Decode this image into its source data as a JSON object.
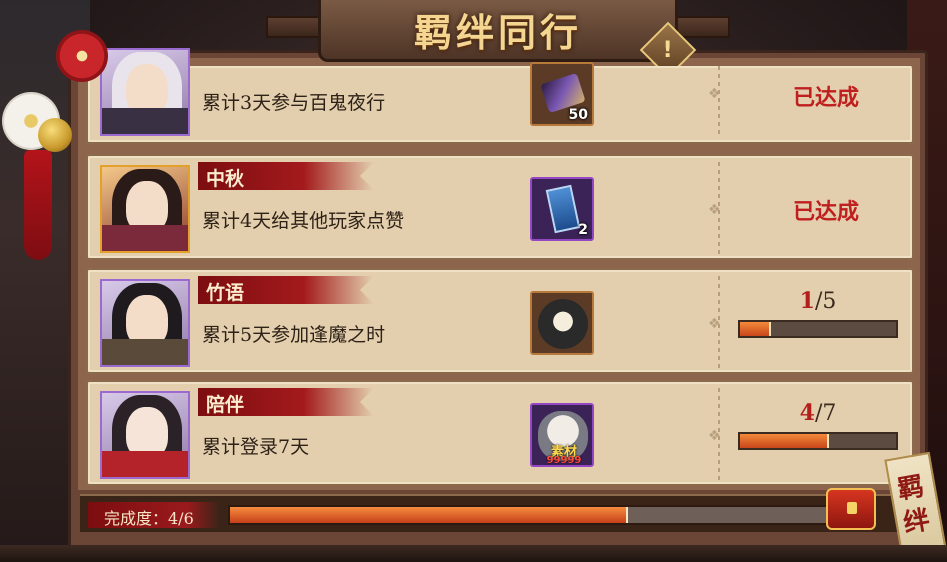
{
  "header": {
    "title": "羁绊同行",
    "info_icon": "exclamation-icon",
    "info_glyph": "!"
  },
  "tasks": [
    {
      "name": "",
      "description": "累计3天参与百鬼夜行",
      "reward": {
        "icon": "purple-gem-icon",
        "quantity": "50"
      },
      "status": "已达成"
    },
    {
      "name": "中秋",
      "description": "累计4天给其他玩家点赞",
      "reward": {
        "icon": "blue-ticket-icon",
        "quantity": "2"
      },
      "status": "已达成"
    },
    {
      "name": "竹语",
      "description": "累计5天参加逢魔之时",
      "reward": {
        "icon": "black-daruma-icon",
        "quantity": ""
      },
      "progress": {
        "current": "1",
        "total": "/5",
        "fraction": 0.2
      }
    },
    {
      "name": "陪伴",
      "description": "累计登录7天",
      "reward": {
        "icon": "white-daruma-icon",
        "label": "素材",
        "sub_label": "99999"
      },
      "progress": {
        "current": "4",
        "total": "/7",
        "fraction": 0.571
      }
    }
  ],
  "footer": {
    "label": "完成度：4/6",
    "fraction": 0.667,
    "chest_icon": "treasure-chest-icon"
  },
  "side_banner": {
    "text": "羁绊"
  },
  "colors": {
    "accent_red": "#bf1f1f",
    "progress_orange": "#f28a3a",
    "title_gold": "#f4d690"
  }
}
